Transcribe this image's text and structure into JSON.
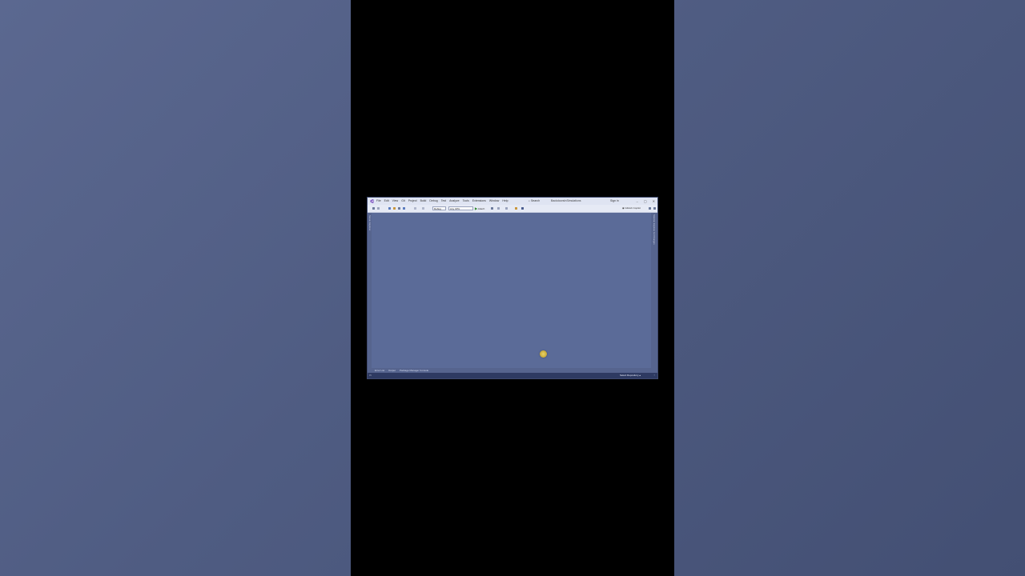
{
  "titlebar": {
    "menu": [
      "File",
      "Edit",
      "View",
      "Git",
      "Project",
      "Build",
      "Debug",
      "Test",
      "Analyze",
      "Tools",
      "Extensions",
      "Window",
      "Help"
    ],
    "search_label": "Search",
    "solution_name": "BackdoorsInSimulations",
    "sign_in": "Sign in",
    "window_controls": [
      "–",
      "▢",
      "✕"
    ]
  },
  "toolbar": {
    "config_value": "Debug",
    "platform_value": "Any CPU",
    "start_label": "Attach",
    "start_glyph": "▶",
    "copilot_label": "GitHub Copilot"
  },
  "side_panels": {
    "left_label": "Server Explorer",
    "right_label": "Solution Explorer  Git Changes"
  },
  "bottom_tabs": [
    "Error List",
    "Output",
    "Package Manager Console"
  ],
  "statusbar": {
    "repo_label": "Select Repository ▴"
  },
  "colors": {
    "background": "#4f5c82",
    "editor": "#5b6b98",
    "statusbar": "#2e3a62",
    "highlight": "#c9a933"
  },
  "icons": [
    "vs-logo-icon",
    "search-icon",
    "play-icon",
    "copilot-icon",
    "bell-icon",
    "cursor-highlight"
  ]
}
